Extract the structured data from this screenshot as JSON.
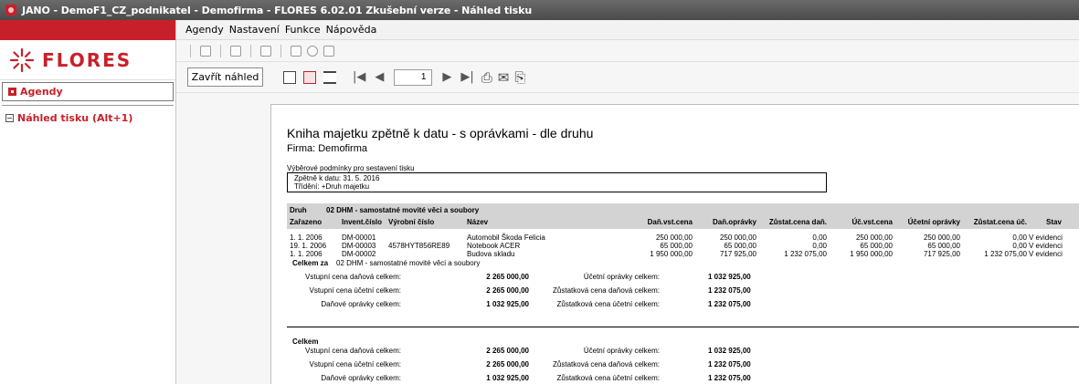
{
  "title_bar": {
    "text": "JANO - DemoF1_CZ_podnikatel - Demofirma - FLORES 6.02.01 Zkušební verze - Náhled tisku"
  },
  "logo": {
    "text": "FLORES"
  },
  "sidebar": {
    "items": [
      {
        "label": "Agendy"
      },
      {
        "label": "Náhled tisku (Alt+1)"
      }
    ]
  },
  "menu": {
    "items": [
      {
        "label": "Agendy"
      },
      {
        "label": "Nastavení"
      },
      {
        "label": "Funkce"
      },
      {
        "label": "Nápověda"
      }
    ]
  },
  "toolbar2": {
    "close_label": "Zavřít náhled",
    "page": "1"
  },
  "document": {
    "title": "Kniha majetku zpětně k datu - s oprávkami - dle druhu",
    "firm": "Firma: Demofirma",
    "conditions_label": "Výběrové podmínky pro sestavení tisku",
    "conditions": [
      "Zpětně k datu: 31. 5. 2016",
      "Třídění: +Druh majetku"
    ],
    "group": {
      "druh_label": "Druh",
      "druh_value": "02 DHM - samostatné movité věci a soubory"
    },
    "columns": {
      "zarazeno": "Zařazeno",
      "invent": "Invent.číslo",
      "vyrobni": "Výrobní číslo",
      "nazev": "Název",
      "dan_vst": "Daň.vst.cena",
      "dan_opr": "Daň.oprávky",
      "zust_dan": "Zůstat.cena daň.",
      "uc_vst": "Úč.vst.cena",
      "uc_opr": "Účetní oprávky",
      "zust_uc": "Zůstat.cena úč.",
      "stav": "Stav"
    },
    "rows": [
      {
        "zarazeno": "1. 1. 2006",
        "invent": "DM-00001",
        "vyrobni": "",
        "nazev": "Automobil Škoda Felicia",
        "dan_vst": "250 000,00",
        "dan_opr": "250 000,00",
        "zust_dan": "0,00",
        "uc_vst": "250 000,00",
        "uc_opr": "250 000,00",
        "zust_uc": "0,00",
        "stav": "V evidenci"
      },
      {
        "zarazeno": "19. 1. 2006",
        "invent": "DM-00003",
        "vyrobni": "4578HYT856RE89",
        "nazev": "Notebook ACER",
        "dan_vst": "65 000,00",
        "dan_opr": "65 000,00",
        "zust_dan": "0,00",
        "uc_vst": "65 000,00",
        "uc_opr": "65 000,00",
        "zust_uc": "0,00",
        "stav": "V evidenci"
      },
      {
        "zarazeno": "1. 1. 2006",
        "invent": "DM-00002",
        "vyrobni": "",
        "nazev": "Budova skladu",
        "dan_vst": "1 950 000,00",
        "dan_opr": "717 925,00",
        "zust_dan": "1 232 075,00",
        "uc_vst": "1 950 000,00",
        "uc_opr": "717 925,00",
        "zust_uc": "1 232 075,00",
        "stav": "V evidenci"
      }
    ],
    "group_total": {
      "label": "Celkem za",
      "druh": "02 DHM - samostatné movité věci a soubory",
      "lines": [
        {
          "l1": "Vstupní cena daňová celkem:",
          "v1": "2 265 000,00",
          "l2": "Účetní oprávky celkem:",
          "v2": "1 032 925,00"
        },
        {
          "l1": "Vstupní cena účetní celkem:",
          "v1": "2 265 000,00",
          "l2": "Zůstatková cena daňová celkem:",
          "v2": "1 232 075,00"
        },
        {
          "l1": "Daňové oprávky celkem:",
          "v1": "1 032 925,00",
          "l2": "Zůstatková cena účetní celkem:",
          "v2": "1 232 075,00"
        }
      ]
    },
    "grand_total": {
      "label": "Celkem",
      "lines": [
        {
          "l1": "Vstupní cena daňová celkem:",
          "v1": "2 265 000,00",
          "l2": "Účetní oprávky celkem:",
          "v2": "1 032 925,00"
        },
        {
          "l1": "Vstupní cena účetní celkem:",
          "v1": "2 265 000,00",
          "l2": "Zůstatková cena daňová celkem:",
          "v2": "1 232 075,00"
        },
        {
          "l1": "Daňové oprávky celkem:",
          "v1": "1 032 925,00",
          "l2": "Zůstatková cena účetní celkem:",
          "v2": "1 232 075,00"
        }
      ]
    }
  }
}
